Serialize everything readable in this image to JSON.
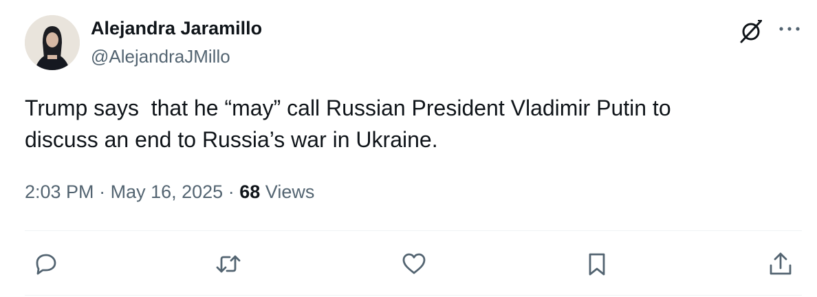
{
  "tweet": {
    "author": {
      "display_name": "Alejandra Jaramillo",
      "handle": "@AlejandraJMillo",
      "avatar_icon": "profile-photo"
    },
    "text": "Trump says  that he “may” call Russian President Vladimir Putin to\ndiscuss an end to Russia’s war in Ukraine.",
    "time": "2:03 PM",
    "separator": "·",
    "date": "May 16, 2025",
    "views_count": "68",
    "views_label": "Views"
  },
  "header_actions": {
    "grok_icon": "grok-icon",
    "more_icon": "more-icon"
  },
  "actions": [
    {
      "name": "reply",
      "icon": "reply-icon"
    },
    {
      "name": "retweet",
      "icon": "retweet-icon"
    },
    {
      "name": "like",
      "icon": "heart-icon"
    },
    {
      "name": "bookmark",
      "icon": "bookmark-icon"
    },
    {
      "name": "share",
      "icon": "share-icon"
    }
  ],
  "colors": {
    "text_primary": "#0f1419",
    "text_secondary": "#536471",
    "divider": "#eff3f4",
    "icon": "#536471"
  }
}
